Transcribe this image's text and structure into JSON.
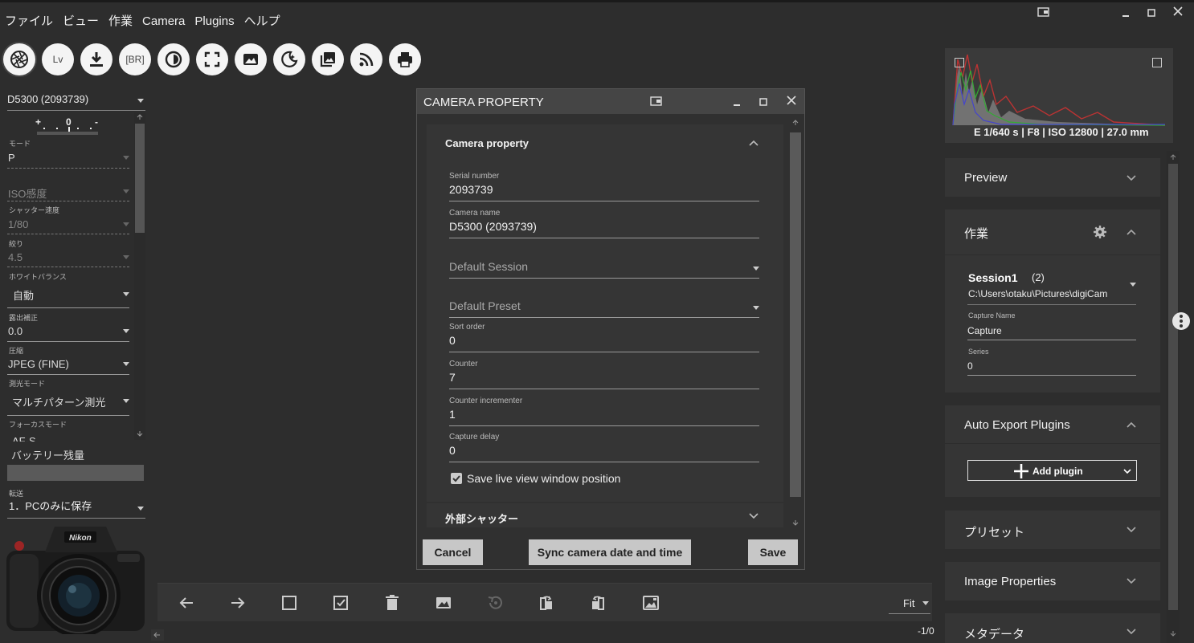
{
  "menu": [
    "ファイル",
    "ビュー",
    "作業",
    "Camera",
    "Plugins",
    "ヘルプ"
  ],
  "toolbar": {
    "lv_label": "Lv",
    "br_label": "[BR]"
  },
  "left": {
    "camera_select": "D5300 (2093739)",
    "exposure_scale": "+ . . 0 . . -",
    "mode_label": "モード",
    "mode_value": "P",
    "iso_label": "ISO感度",
    "shutter_label": "シャッター速度",
    "shutter_value": "1/80",
    "aperture_label": "絞り",
    "aperture_value": "4.5",
    "wb_label": "ホワイトバランス",
    "wb_value": "自動",
    "ev_label": "露出補正",
    "ev_value": "0.0",
    "compression_label": "圧縮",
    "compression_value": "JPEG (FINE)",
    "metering_label": "測光モード",
    "metering_value": "マルチパターン測光",
    "focus_label": "フォーカスモード",
    "focus_value": "AF-S",
    "battery_label": "バッテリー残量",
    "transfer_label": "転送",
    "transfer_value": "1．PCのみに保存"
  },
  "dialog": {
    "title": "CAMERA PROPERTY",
    "section_title": "Camera property",
    "serial_label": "Serial number",
    "serial_value": "2093739",
    "name_label": "Camera name",
    "name_value": "D5300 (2093739)",
    "default_session": "Default Session",
    "default_preset": "Default Preset",
    "sort_label": "Sort order",
    "sort_value": "0",
    "counter_label": "Counter",
    "counter_value": "7",
    "incr_label": "Counter incrementer",
    "incr_value": "1",
    "delay_label": "Capture delay",
    "delay_value": "0",
    "save_pos_label": "Save live view window position",
    "save_pos_checked": true,
    "external_shutter": "外部シャッター",
    "cancel": "Cancel",
    "sync": "Sync camera date and time",
    "save": "Save"
  },
  "bottom": {
    "zoom": "Fit",
    "counter": "-1/0"
  },
  "right": {
    "histogram_info": "E 1/640 s | F8 | ISO 12800 | 27.0 mm",
    "preview": "Preview",
    "work": "作業",
    "session_name": "Session1",
    "session_count": "(2)",
    "session_path": "C:\\Users\\otaku\\Pictures\\digiCam",
    "capture_name_label": "Capture Name",
    "capture_name_value": "Capture",
    "series_label": "Series",
    "series_value": "0",
    "auto_export": "Auto Export Plugins",
    "add_plugin": "Add plugin",
    "preset": "プリセット",
    "image_properties": "Image Properties",
    "metadata": "メタデータ"
  },
  "colors": {
    "bg": "#2d2d2d",
    "panel": "#353535",
    "button": "#c7c7c7"
  }
}
